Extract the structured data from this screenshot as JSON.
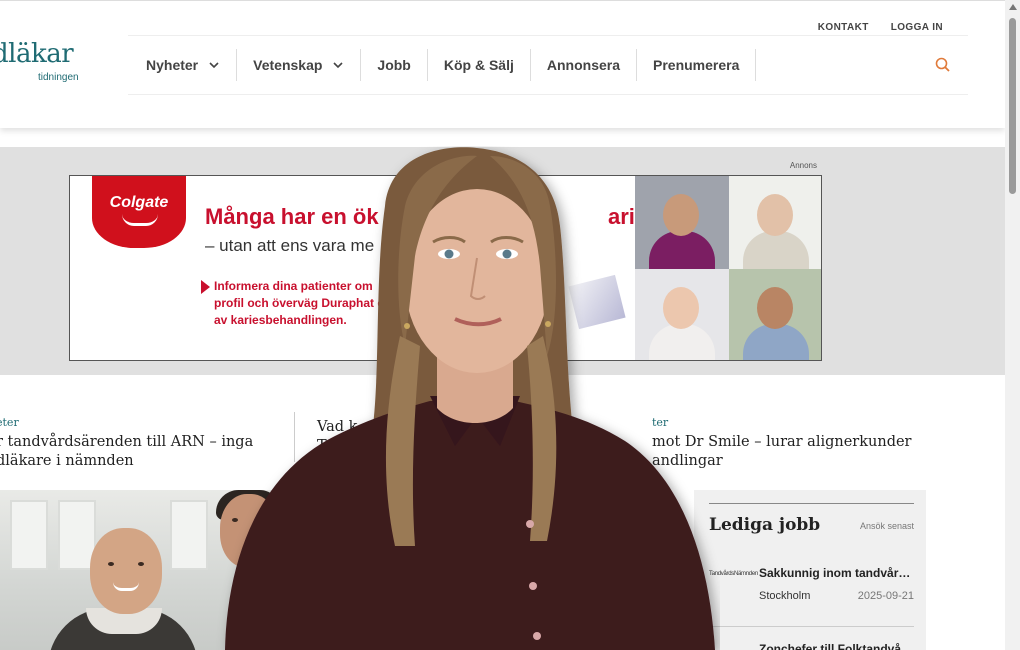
{
  "header": {
    "logo_main": "dläkar",
    "logo_sub": "tidningen",
    "top_links": [
      "KONTAKT",
      "LOGGA IN"
    ],
    "nav": [
      {
        "label": "Nyheter",
        "dropdown": true
      },
      {
        "label": "Vetenskap",
        "dropdown": true
      },
      {
        "label": "Jobb",
        "dropdown": false
      },
      {
        "label": "Köp & Sälj",
        "dropdown": false
      },
      {
        "label": "Annonsera",
        "dropdown": false
      },
      {
        "label": "Prenumerera",
        "dropdown": false
      }
    ],
    "search_icon": "search-icon"
  },
  "ad": {
    "label": "Annons",
    "brand": "Colgate",
    "headline": "Många har en ök",
    "headline_end": "aries",
    "subline": "– utan att ens vara me",
    "body": "Informera dina patienter om profil och överväg Duraphat del av kariesbehandlingen.",
    "accent": "#c8102e"
  },
  "articles": [
    {
      "category": "eter",
      "title": "r tandvårdsärenden till ARN – inga\ndläkare i nämnden"
    },
    {
      "category": "",
      "title": "Vad k\nT"
    },
    {
      "category": "ter",
      "title": "mot Dr Smile – lurar alignerkunder\nandlingar"
    }
  ],
  "jobs": {
    "title": "Lediga jobb",
    "column_header": "Ansök senast",
    "items": [
      {
        "logo": "TandvårdsNämnden",
        "title": "Sakkunnig inom tandvård ...",
        "location": "Stockholm",
        "date": "2025-09-21"
      },
      {
        "logo": "",
        "title": "Zonchefer till Folktandvå...",
        "location": "",
        "date": ""
      }
    ]
  },
  "colors": {
    "brand": "#1f6b73",
    "nav_text": "#444444",
    "search": "#e07a3a"
  }
}
